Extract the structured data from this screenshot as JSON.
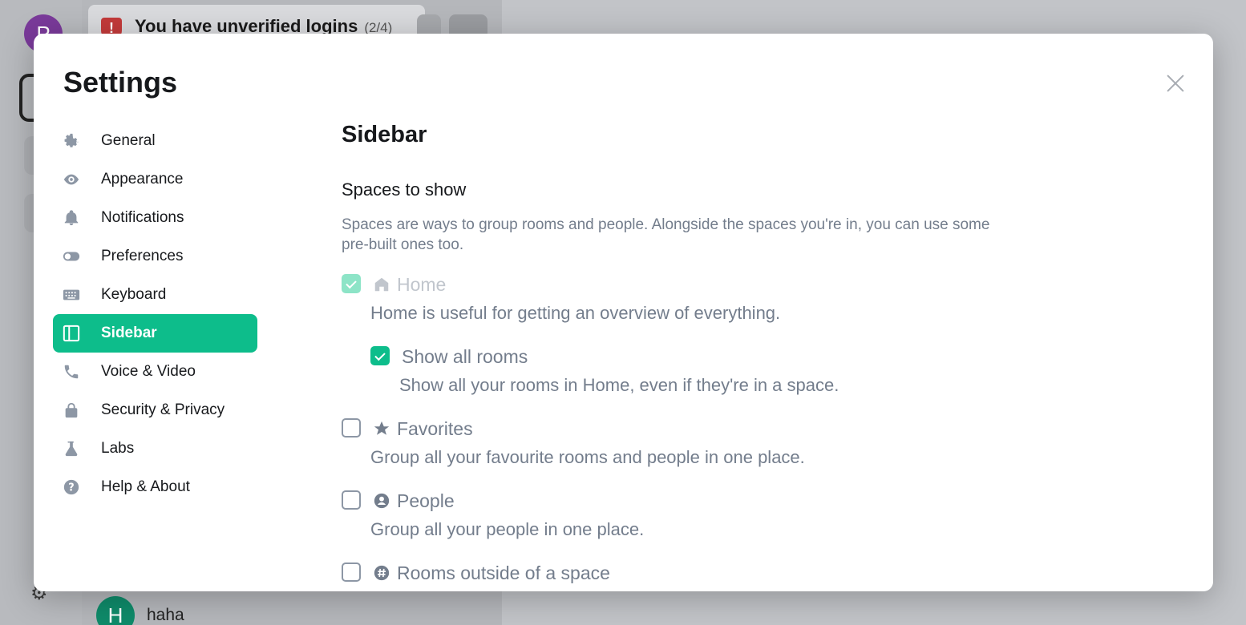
{
  "background": {
    "user_initial": "P",
    "toast_title": "You have unverified logins",
    "toast_count": "(2/4)",
    "room_initial": "H",
    "room_name": "haha"
  },
  "dialog": {
    "title": "Settings",
    "close_icon": "close-icon"
  },
  "nav": {
    "items": [
      {
        "label": "General",
        "icon": "gear-icon"
      },
      {
        "label": "Appearance",
        "icon": "eye-icon"
      },
      {
        "label": "Notifications",
        "icon": "bell-icon"
      },
      {
        "label": "Preferences",
        "icon": "toggle-icon"
      },
      {
        "label": "Keyboard",
        "icon": "keyboard-icon"
      },
      {
        "label": "Sidebar",
        "icon": "sidebar-icon",
        "active": true
      },
      {
        "label": "Voice & Video",
        "icon": "phone-icon"
      },
      {
        "label": "Security & Privacy",
        "icon": "lock-icon"
      },
      {
        "label": "Labs",
        "icon": "flask-icon"
      },
      {
        "label": "Help & About",
        "icon": "help-icon"
      }
    ]
  },
  "sidebar_settings": {
    "title": "Sidebar",
    "subheading": "Spaces to show",
    "description": "Spaces are ways to group rooms and people. Alongside the spaces you're in, you can use some pre-built ones too.",
    "options": {
      "home": {
        "label": "Home",
        "description": "Home is useful for getting an overview of everything.",
        "checked": true,
        "disabled": true,
        "icon": "home-icon"
      },
      "show_all_rooms": {
        "label": "Show all rooms",
        "description": "Show all your rooms in Home, even if they're in a space.",
        "checked": true
      },
      "favorites": {
        "label": "Favorites",
        "description": "Group all your favourite rooms and people in one place.",
        "checked": false,
        "icon": "star-icon"
      },
      "people": {
        "label": "People",
        "description": "Group all your people in one place.",
        "checked": false,
        "icon": "person-icon"
      },
      "rooms_outside": {
        "label": "Rooms outside of a space",
        "checked": false,
        "icon": "hash-icon"
      }
    }
  },
  "colors": {
    "accent": "#0dbd8b",
    "muted_text": "#737d8c",
    "primary_text": "#17191c"
  }
}
